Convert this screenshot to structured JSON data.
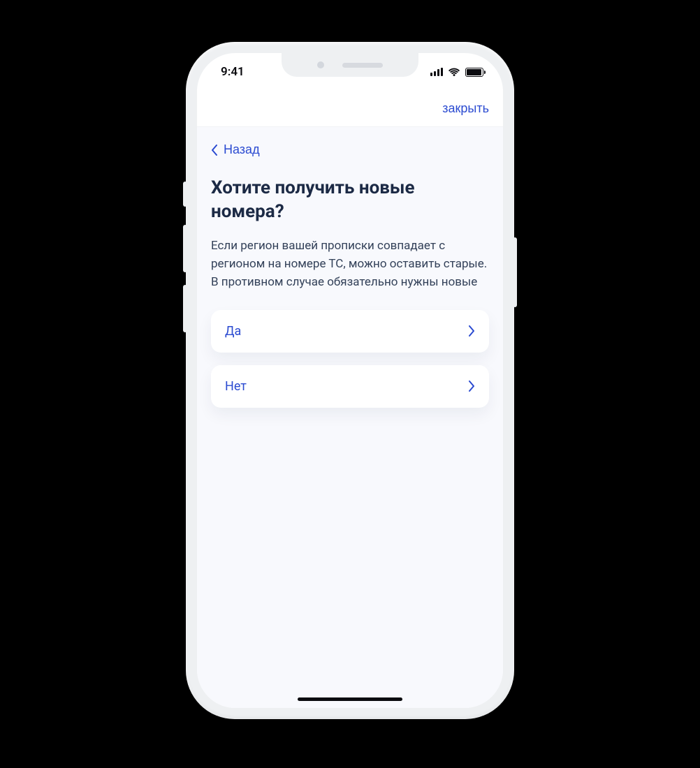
{
  "status": {
    "time": "9:41"
  },
  "nav": {
    "close_label": "закрыть"
  },
  "back": {
    "label": "Назад"
  },
  "page": {
    "title": "Хотите получить новые номера?",
    "description": "Если регион вашей прописки совпадает с регионом на номере ТС, можно оставить старые. В противном случае обязательно нужны новые"
  },
  "options": [
    {
      "label": "Да"
    },
    {
      "label": "Нет"
    }
  ]
}
